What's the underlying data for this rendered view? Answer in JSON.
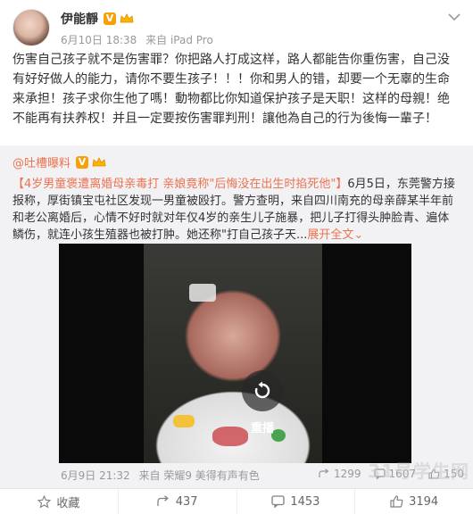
{
  "post": {
    "author": "伊能靜",
    "vip_badge": "V",
    "date": "6月10日 18:38",
    "source": "来自 iPad Pro",
    "text": "伤害自己孩子就不是伤害罪？你把路人打成这样，路人都能告你重伤害，自己没有好好做人的能力，请你不要生孩子！！！你和男人的错，却要一个无辜的生命来承担！孩子求你生他了嗎！動物都比你知道保护孩子是天职！这样的母親！绝不能再有扶养权！并且一定要按伤害罪判刑！讓他為自己的行为後悔一輩子！"
  },
  "repost": {
    "author": "@吐槽曝料",
    "vip_badge": "V",
    "hashtag": "【4岁男童褒遭离婚母亲毒打 亲娘竟称\"后悔没在出生时掐死他\"】",
    "body": "6月5日，东莞警方接报称，厚街镇宝屯社区发现一男童被殴打。警方查明，来自四川南充的母亲薛某半年前和老公离婚后，心情不好时就对年仅4岁的亲生儿子施暴，把儿子打得头肿脸青、遍体鳞伤，就连小孩生殖器也被打肿。她还称\"打自己孩子天...",
    "expand": "展开全文",
    "expand_arrow": "⌄",
    "video": {
      "replay_label": "重播"
    },
    "footer": {
      "date": "6月9日 21:32",
      "source": "来自 荣耀9 美得有声有色",
      "repost_count": "1299",
      "comment_count": "1607",
      "like_count": "150"
    }
  },
  "actions": {
    "favorite": "收藏",
    "repost": "437",
    "comment": "1453",
    "like": "3194"
  },
  "watermark": "31号学生网",
  "colors": {
    "accent": "#eb7350",
    "vip": "#f6a10a",
    "repost_bg": "#f2f2f5"
  }
}
